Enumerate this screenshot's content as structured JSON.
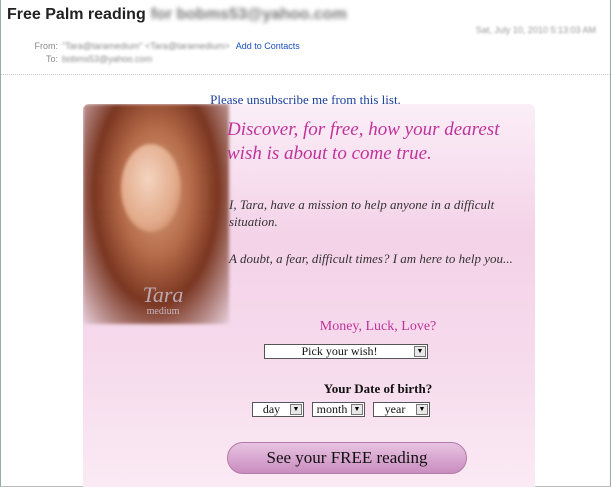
{
  "email": {
    "subject": "Free Palm reading",
    "subject_recipient": "for bobms53@yahoo.com",
    "date": "Sat, July 10, 2010 5:13:03 AM",
    "from_label": "From:",
    "from_value": "\"Tara@taramedium\" <Tara@taramedium>",
    "to_label": "To:",
    "to_value": "bobms53@yahoo.com",
    "add_contacts": "Add to Contacts"
  },
  "body": {
    "unsubscribe": "Please unsubscribe me from this list.",
    "headline": "Discover, for free, how your dearest wish is about to come true.",
    "para1": "I, Tara, have a mission to help anyone in a difficult situation.",
    "para2": "A doubt, a fear, difficult times? I am here to help you...",
    "signature_name": "Tara",
    "signature_role": "medium",
    "question1": "Money, Luck, Love?",
    "wish_select": "Pick your wish!",
    "question2": "Your Date of birth?",
    "day_select": "day",
    "month_select": "month",
    "year_select": "year",
    "cta": "See your FREE reading"
  },
  "icons": {
    "dropdown_arrow": "▼"
  },
  "colors": {
    "accent_pink": "#c0339a",
    "link_blue": "#1c3d9a"
  }
}
